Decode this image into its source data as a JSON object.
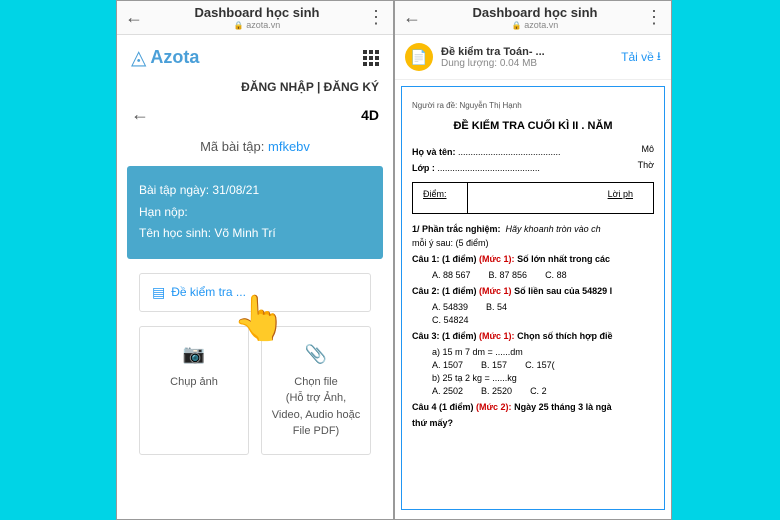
{
  "left": {
    "browser": {
      "title": "Dashboard học sinh",
      "url": "azota.vn"
    },
    "logo": "Azota",
    "auth": {
      "login": "ĐĂNG NHẬP",
      "sep": "|",
      "signup": "ĐĂNG KÝ"
    },
    "class": "4D",
    "code_label": "Mã bài tập:",
    "code": "mfkebv",
    "card": {
      "date_label": "Bài tập ngày:",
      "date": "31/08/21",
      "due_label": "Hạn nộp:",
      "student_label": "Tên học sinh:",
      "student": "Võ Minh Trí"
    },
    "exam_link": "Đề kiểm tra ...",
    "actions": {
      "photo": {
        "label": "Chụp ảnh"
      },
      "file": {
        "label": "Chọn file",
        "hint": "(Hỗ trợ Ảnh, Video, Audio hoặc File PDF)"
      }
    }
  },
  "right": {
    "browser": {
      "title": "Dashboard học sinh",
      "url": "azota.vn"
    },
    "download": {
      "title": "Đề kiểm tra Toán- ...",
      "size_label": "Dung lượng:",
      "size": "0.04 MB",
      "action": "Tải về"
    },
    "doc": {
      "author_label": "Người ra đề:",
      "author": "Nguyễn Thị Hạnh",
      "title": "ĐỀ KIỂM TRA CUỐI  KÌ II .  NĂM",
      "name": "Họ và tên:",
      "class": "Lớp :",
      "subject": "Mô",
      "time": "Thờ",
      "score": "Điểm:",
      "comment": "Lời ph",
      "section1": "1/ Phần trắc nghiệm:",
      "section1_instr": "Hãy khoanh tròn vào ch",
      "section1_note": "mỗi ý sau: (5 điểm)",
      "q1": {
        "label": "Câu 1: (1 điểm)",
        "level": "(Mức 1):",
        "text": "Số lớn nhất trong các",
        "a": "A. 88 567",
        "b": "B. 87 856",
        "c": "C. 88"
      },
      "q2": {
        "label": "Câu 2: (1 điểm)",
        "level": "(Mức 1)",
        "text": "Số liền sau của 54829 l",
        "a": "A. 54839",
        "b": "B. 54",
        "c": "C. 54824"
      },
      "q3": {
        "label": "Câu 3: (1 điểm)",
        "level": "(Mức 1):",
        "text": "Chọn số thích hợp điề",
        "line1": "a) 15 m 7 dm  =  ......dm",
        "a": "A. 1507",
        "b": "B. 157",
        "c": "C. 157(",
        "line2": "b) 25 tạ 2 kg = ......kg",
        "a2": "A. 2502",
        "b2": "B. 2520",
        "c2": "C. 2"
      },
      "q4": {
        "label": "Câu 4 (1 điểm)",
        "level": "(Mức 2):",
        "text": "Ngày 25 tháng 3 là ngà",
        "text2": "thứ mấy?"
      }
    }
  }
}
